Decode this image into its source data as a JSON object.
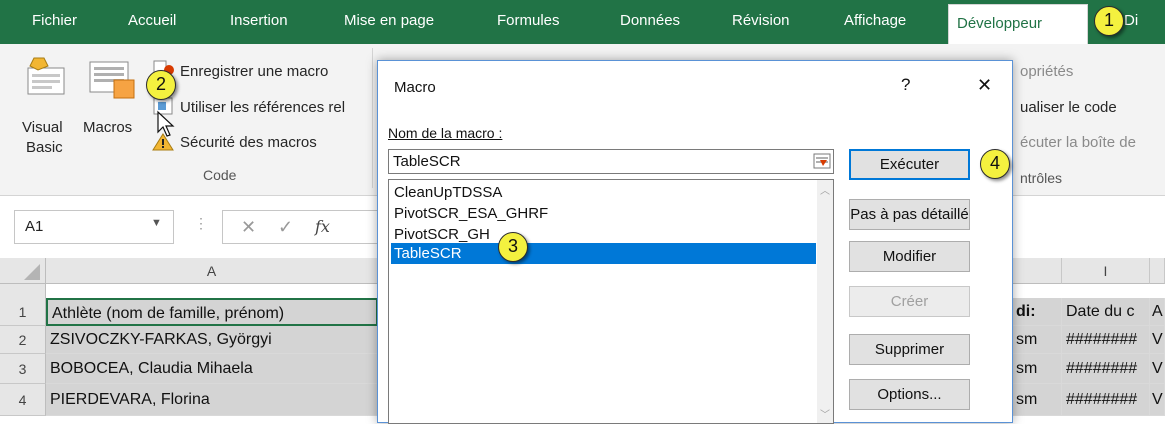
{
  "ribbon": {
    "tabs": [
      "Fichier",
      "Accueil",
      "Insertion",
      "Mise en page",
      "Formules",
      "Données",
      "Révision",
      "Affichage",
      "Développeur",
      "Di"
    ],
    "active_tab": "Développeur",
    "code_group": {
      "visual_basic_line1": "Visual",
      "visual_basic_line2": "Basic",
      "macros": "Macros",
      "record_macro": "Enregistrer une macro",
      "relative_refs": "Utiliser les références rel",
      "macro_security": "Sécurité des macros",
      "group_label": "Code"
    },
    "controls_group": {
      "properties": "opriétés",
      "view_code": "ualiser le code",
      "run_dialog": "écuter la boîte de",
      "group_label": "ntrôles"
    }
  },
  "formula_bar": {
    "name_box": "A1",
    "fx": "fx"
  },
  "sheet": {
    "col_headers": [
      "A",
      "I"
    ],
    "rows": [
      {
        "num": "1",
        "a": "Athlète (nom de famille, prénom)",
        "h": "di:",
        "i": "Date du c",
        "j": "A"
      },
      {
        "num": "2",
        "a": "ZSIVOCZKY-FARKAS, Györgyi",
        "h": "sm",
        "i": "########",
        "j": "V"
      },
      {
        "num": "3",
        "a": "BOBOCEA, Claudia Mihaela",
        "h": "sm",
        "i": "########",
        "j": "V"
      },
      {
        "num": "4",
        "a": "PIERDEVARA, Florina",
        "h": "sm",
        "i": "########",
        "j": "V"
      }
    ]
  },
  "dialog": {
    "title": "Macro",
    "help": "?",
    "close": "✕",
    "name_label": "Nom de la macro :",
    "name_value": "TableSCR",
    "macros": [
      "CleanUpTDSSA",
      "PivotSCR_ESA_GHRF",
      "PivotSCR_GH",
      "TableSCR"
    ],
    "selected_macro": "TableSCR",
    "buttons": {
      "run": "Exécuter",
      "step_into": "Pas à pas détaillé",
      "edit": "Modifier",
      "create": "Créer",
      "delete": "Supprimer",
      "options": "Options..."
    }
  },
  "badges": [
    "1",
    "2",
    "3",
    "4"
  ],
  "colors": {
    "ribbon_green": "#217346",
    "selection_blue": "#0078d7",
    "badge_yellow": "#f4f13f"
  }
}
